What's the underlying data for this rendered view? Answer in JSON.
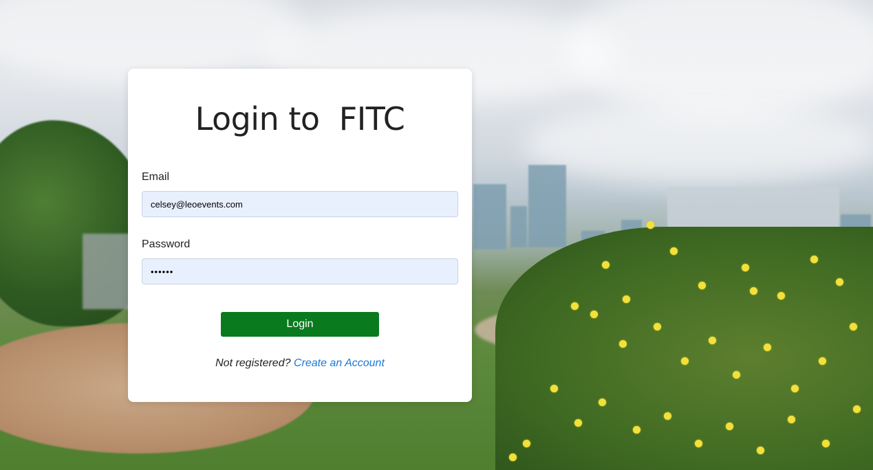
{
  "login": {
    "title": "Login to  FITC",
    "email_label": "Email",
    "email_value": "celsey@leoevents.com",
    "password_label": "Password",
    "password_value": "••••••",
    "login_button": "Login",
    "register_prompt": "Not registered?",
    "register_link": "Create an Account"
  },
  "colors": {
    "card_bg": "#ffffff",
    "input_bg": "#e8f0fe",
    "button_bg": "#0a7a1f",
    "link": "#1a78d6"
  }
}
